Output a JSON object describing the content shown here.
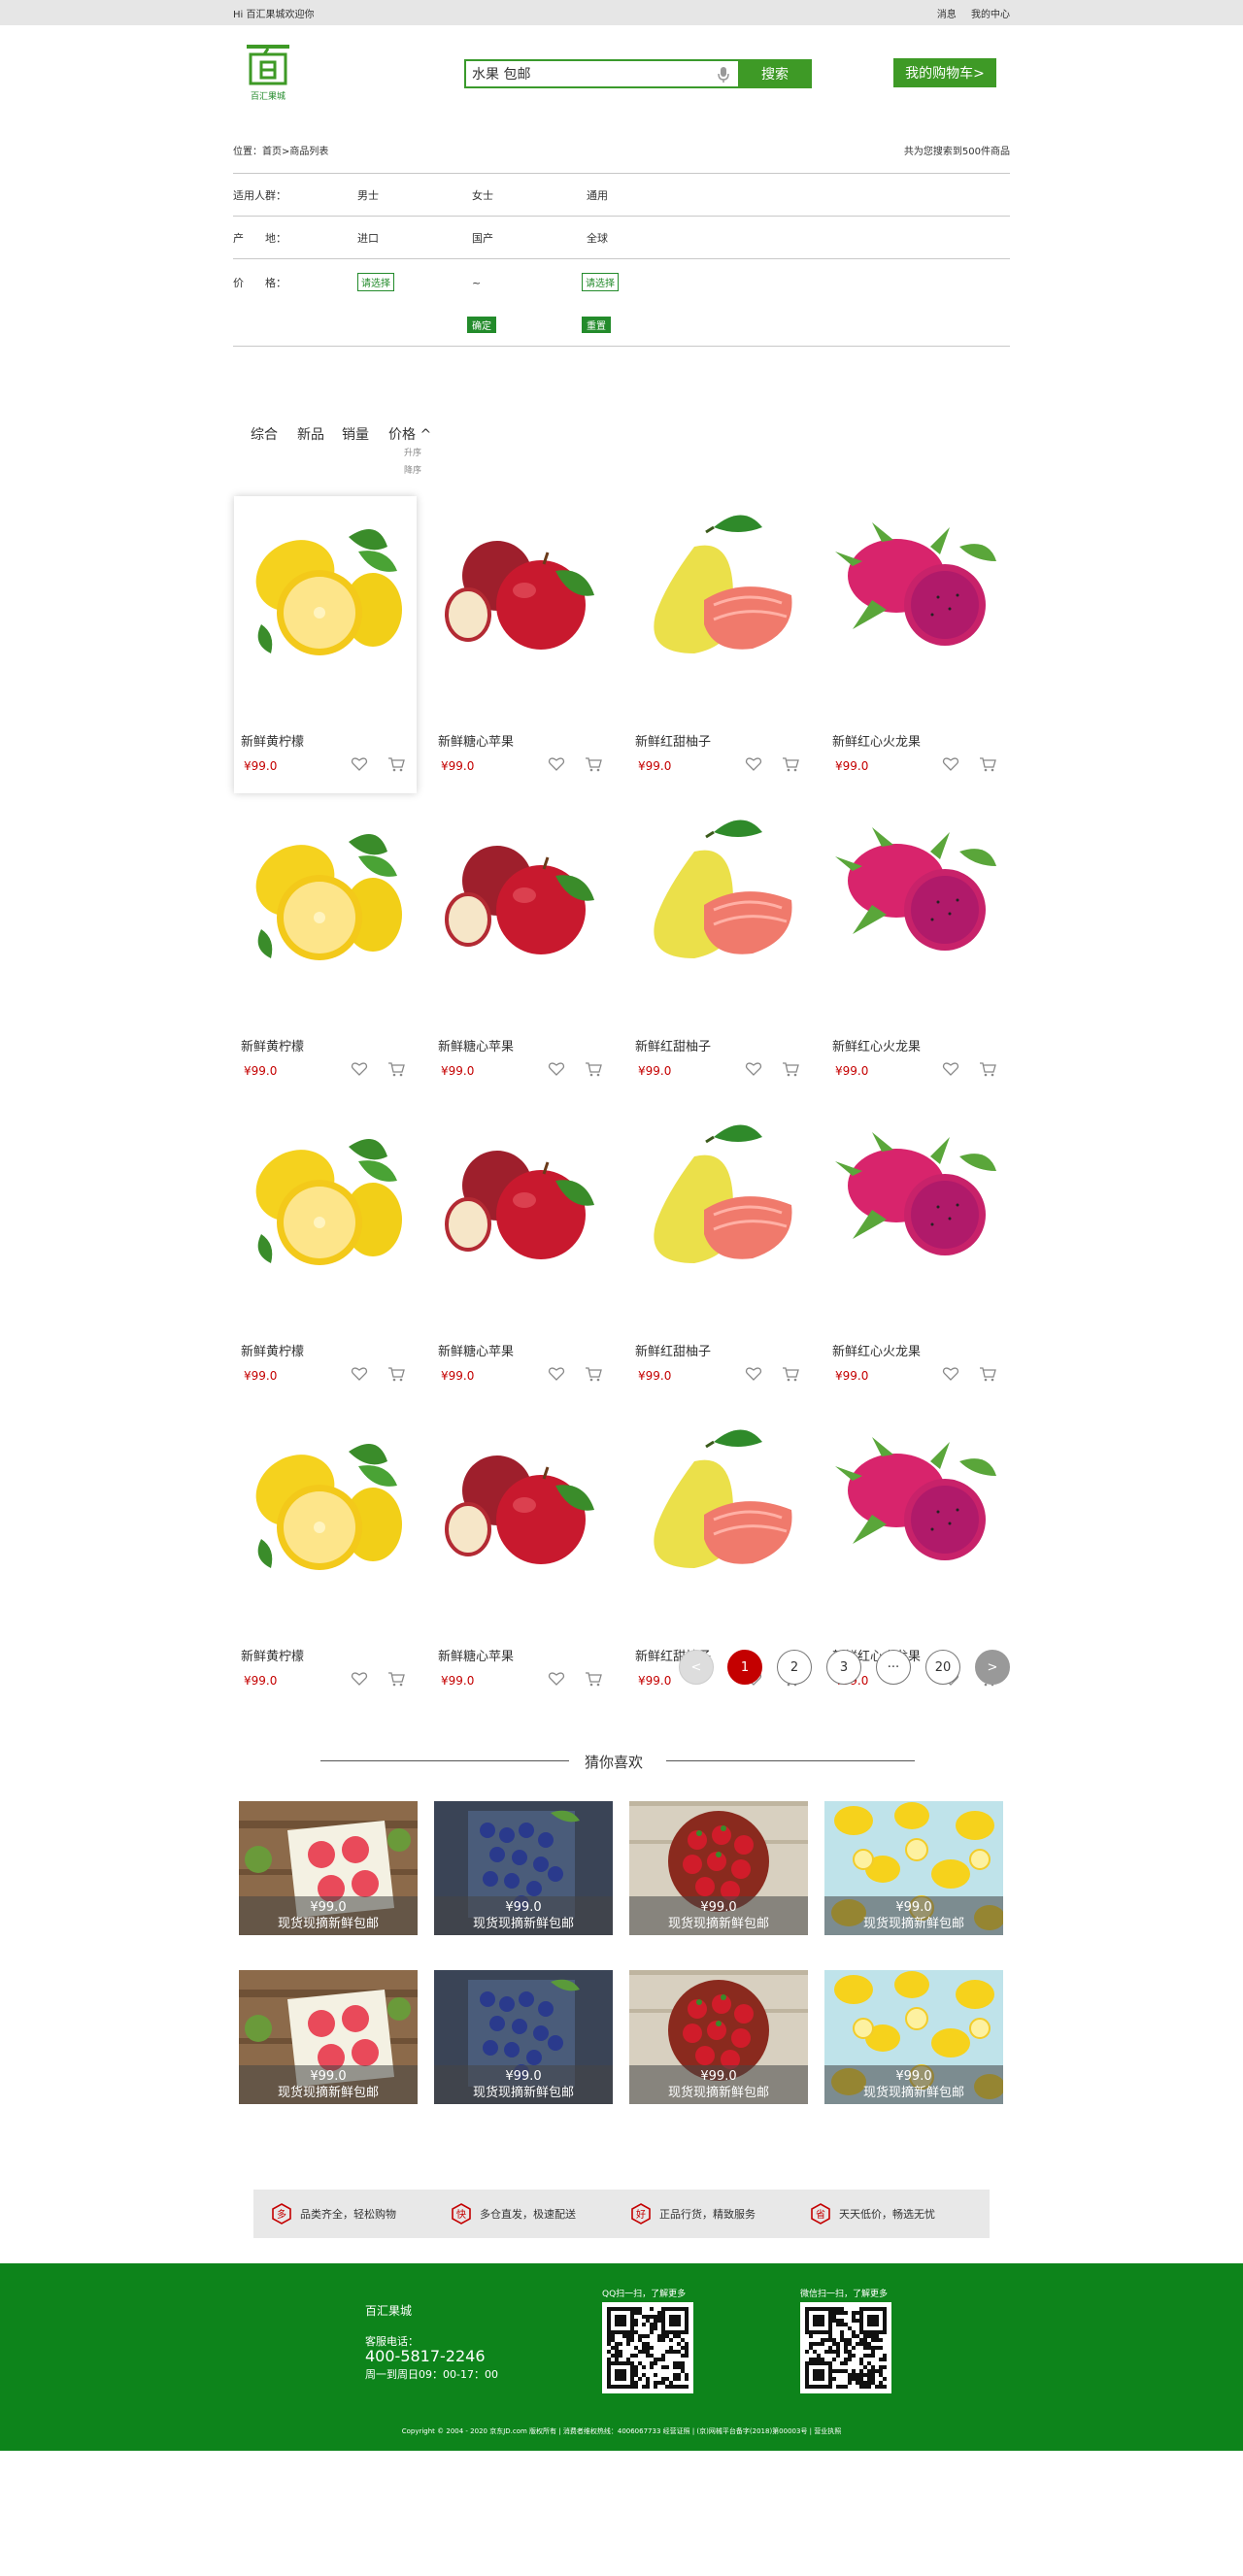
{
  "topbar": {
    "welcome": "Hi 百汇果城欢迎你",
    "links": [
      "消息",
      "我的中心"
    ]
  },
  "logo": {
    "text": "百汇果城"
  },
  "search": {
    "value": "水果 包邮",
    "button": "搜索"
  },
  "cart_button": "我的购物车>",
  "breadcrumb": {
    "text": "位置：首页>商品列表",
    "count": "共为您搜索到500件商品"
  },
  "filters": {
    "crowd": {
      "label": "适用人群：",
      "options": [
        "男士",
        "女士",
        "通用"
      ]
    },
    "origin": {
      "label": "产　　地：",
      "options": [
        "进口",
        "国产",
        "全球"
      ]
    },
    "price": {
      "label": "价　　格：",
      "pick1": "请选择",
      "tilde": "~",
      "pick2": "请选择",
      "confirm": "确定",
      "reset": "重置"
    }
  },
  "sort": {
    "options": [
      "综合",
      "新品",
      "销量",
      "价格 ^"
    ],
    "asc": "升序",
    "desc": "降序"
  },
  "products": [
    {
      "name": "新鲜黄柠檬",
      "price": "¥99.0",
      "type": "lemon"
    },
    {
      "name": "新鲜糖心苹果",
      "price": "¥99.0",
      "type": "apple"
    },
    {
      "name": "新鲜红甜柚子",
      "price": "¥99.0",
      "type": "pomelo"
    },
    {
      "name": "新鲜红心火龙果",
      "price": "¥99.0",
      "type": "dragon"
    },
    {
      "name": "新鲜黄柠檬",
      "price": "¥99.0",
      "type": "lemon"
    },
    {
      "name": "新鲜糖心苹果",
      "price": "¥99.0",
      "type": "apple"
    },
    {
      "name": "新鲜红甜柚子",
      "price": "¥99.0",
      "type": "pomelo"
    },
    {
      "name": "新鲜红心火龙果",
      "price": "¥99.0",
      "type": "dragon"
    },
    {
      "name": "新鲜黄柠檬",
      "price": "¥99.0",
      "type": "lemon"
    },
    {
      "name": "新鲜糖心苹果",
      "price": "¥99.0",
      "type": "apple"
    },
    {
      "name": "新鲜红甜柚子",
      "price": "¥99.0",
      "type": "pomelo"
    },
    {
      "name": "新鲜红心火龙果",
      "price": "¥99.0",
      "type": "dragon"
    },
    {
      "name": "新鲜黄柠檬",
      "price": "¥99.0",
      "type": "lemon"
    },
    {
      "name": "新鲜糖心苹果",
      "price": "¥99.0",
      "type": "apple"
    },
    {
      "name": "新鲜红甜柚子",
      "price": "¥99.0",
      "type": "pomelo"
    },
    {
      "name": "新鲜红心火龙果",
      "price": "¥99.0",
      "type": "dragon"
    }
  ],
  "pagination": {
    "prev": "<",
    "pages": [
      "1",
      "2",
      "3",
      "···",
      "20"
    ],
    "next": ">",
    "current": "1"
  },
  "recommend": {
    "title": "猜你喜欢",
    "items": [
      {
        "price": "¥99.0",
        "name": "现货现摘新鲜包邮",
        "type": "fig"
      },
      {
        "price": "¥99.0",
        "name": "现货现摘新鲜包邮",
        "type": "blueberry"
      },
      {
        "price": "¥99.0",
        "name": "现货现摘新鲜包邮",
        "type": "strawberry"
      },
      {
        "price": "¥99.0",
        "name": "现货现摘新鲜包邮",
        "type": "lemon"
      },
      {
        "price": "¥99.0",
        "name": "现货现摘新鲜包邮",
        "type": "fig"
      },
      {
        "price": "¥99.0",
        "name": "现货现摘新鲜包邮",
        "type": "blueberry"
      },
      {
        "price": "¥99.0",
        "name": "现货现摘新鲜包邮",
        "type": "strawberry"
      },
      {
        "price": "¥99.0",
        "name": "现货现摘新鲜包邮",
        "type": "lemon"
      }
    ]
  },
  "guarantees": [
    {
      "icon": "多",
      "text": "品类齐全，轻松购物"
    },
    {
      "icon": "快",
      "text": "多仓直发，极速配送"
    },
    {
      "icon": "好",
      "text": "正品行货，精致服务"
    },
    {
      "icon": "省",
      "text": "天天低价，畅选无忧"
    }
  ],
  "footer": {
    "brand": "百汇果城",
    "tel_label": "客服电话：",
    "tel": "400-5817-2246",
    "hours": "周一到周日09：00-17：00",
    "qq_label": "QQ扫一扫，了解更多",
    "wechat_label": "微信扫一扫，了解更多",
    "copyright": "Copyright © 2004 - 2020 京东JD.com 版权所有 | 消费者维权热线：4006067733 经营证照 | (京)网械平台备字(2018)第00003号 | 营业执照"
  },
  "colors": {
    "brand_green": "#3e9a26",
    "footer_green": "#0d841b",
    "price_red": "#c40000"
  }
}
